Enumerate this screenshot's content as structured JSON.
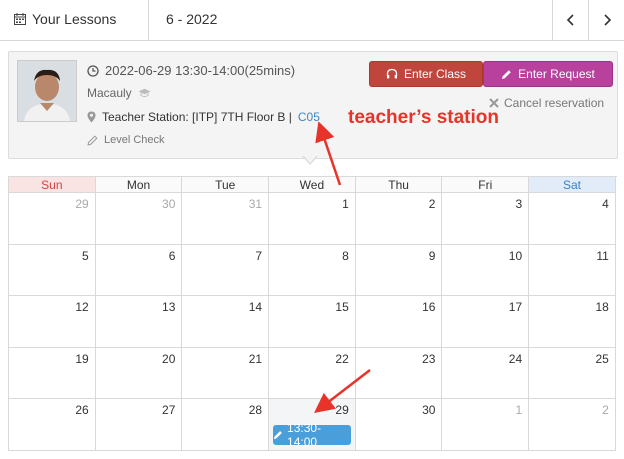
{
  "header": {
    "title": "Your Lessons",
    "month": "6 - 2022",
    "prev_icon": "chevron-left-icon",
    "next_icon": "chevron-right-icon"
  },
  "lesson": {
    "datetime": "2022-06-29  13:30-14:00(25mins)",
    "teacher_name": "Macauly",
    "station_prefix": "Teacher Station: [ITP] 7TH Floor B |",
    "station_code": "C05",
    "level_check": "Level Check",
    "enter_class": "Enter Class",
    "enter_request": "Enter Request",
    "cancel": "Cancel reservation"
  },
  "annotation": "teacher’s station",
  "calendar": {
    "days_of_week": [
      "Sun",
      "Mon",
      "Tue",
      "Wed",
      "Thu",
      "Fri",
      "Sat"
    ],
    "weeks": [
      [
        "29",
        "30",
        "31",
        "1",
        "2",
        "3",
        "4"
      ],
      [
        "5",
        "6",
        "7",
        "8",
        "9",
        "10",
        "11"
      ],
      [
        "12",
        "13",
        "14",
        "15",
        "16",
        "17",
        "18"
      ],
      [
        "19",
        "20",
        "21",
        "22",
        "23",
        "24",
        "25"
      ],
      [
        "26",
        "27",
        "28",
        "29",
        "30",
        "1",
        "2"
      ]
    ],
    "lesson_chip": "13:30-14:00"
  },
  "colors": {
    "enter_class": "#c0463d",
    "enter_request": "#b7419d",
    "chip": "#4a9ed9",
    "annotation": "#e8332a",
    "station_link": "#3a87c8"
  }
}
